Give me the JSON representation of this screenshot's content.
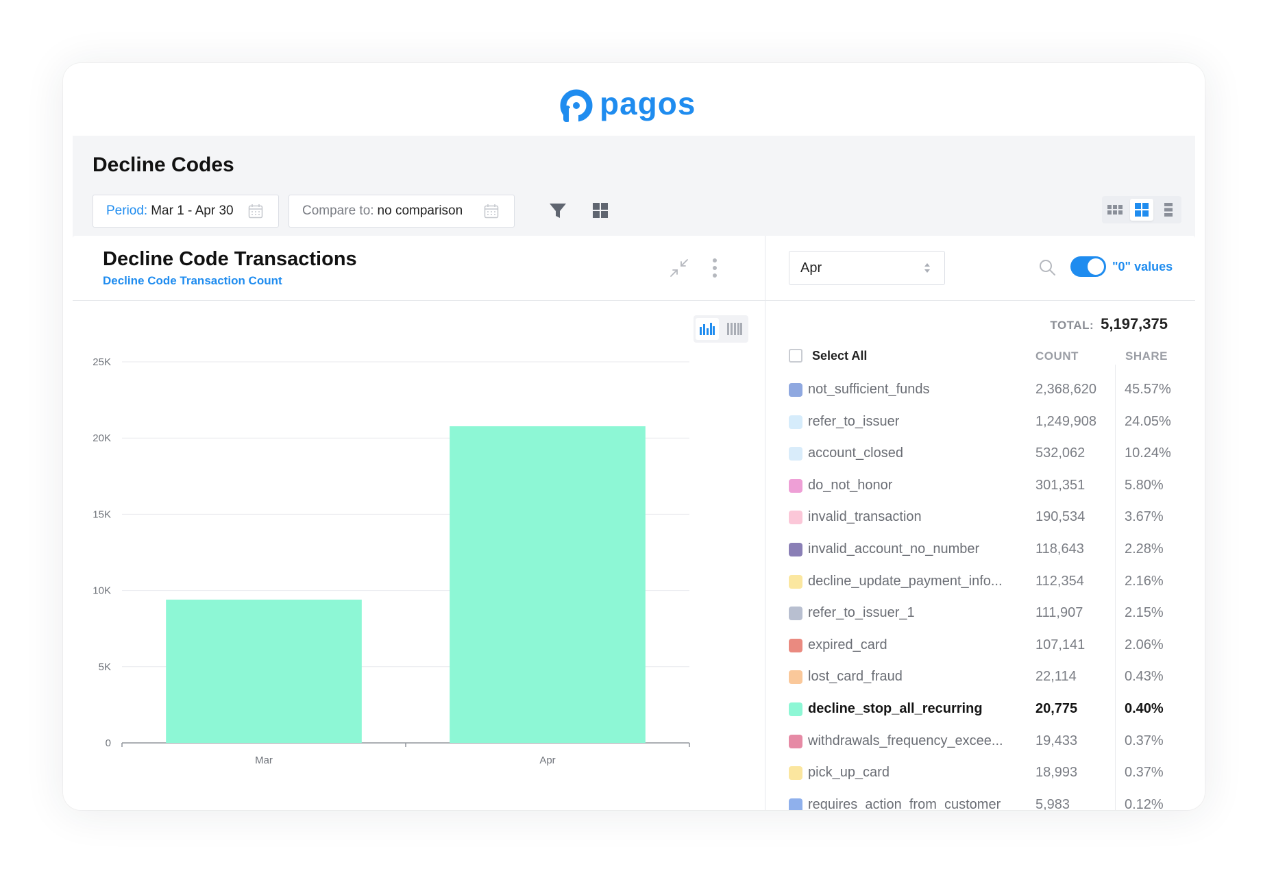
{
  "brand": {
    "name": "pagos",
    "color": "#1f8cef"
  },
  "page": {
    "title": "Decline Codes"
  },
  "filters": {
    "period_label": "Period:",
    "period_value": "Mar 1 - Apr 30",
    "compare_label": "Compare to:",
    "compare_value": "no comparison"
  },
  "panel": {
    "title": "Decline Code Transactions",
    "subtitle": "Decline Code Transaction Count"
  },
  "breakdown": {
    "month": "Apr",
    "toggle_label": "\"0\" values",
    "toggle_on": true,
    "total_label": "TOTAL:",
    "total_value": "5,197,375",
    "select_all": "Select All",
    "col_count": "COUNT",
    "col_share": "SHARE",
    "rows": [
      {
        "name": "not_sufficient_funds",
        "count": "2,368,620",
        "share": "45.57%",
        "color": "#8fa8e0"
      },
      {
        "name": "refer_to_issuer",
        "count": "1,249,908",
        "share": "24.05%",
        "color": "#d6ecfb"
      },
      {
        "name": "account_closed",
        "count": "532,062",
        "share": "10.24%",
        "color": "#d9ecfa"
      },
      {
        "name": "do_not_honor",
        "count": "301,351",
        "share": "5.80%",
        "color": "#ee9fd6"
      },
      {
        "name": "invalid_transaction",
        "count": "190,534",
        "share": "3.67%",
        "color": "#fbc7d8"
      },
      {
        "name": "invalid_account_no_number",
        "count": "118,643",
        "share": "2.28%",
        "color": "#8a7fb6"
      },
      {
        "name": "decline_update_payment_info...",
        "count": "112,354",
        "share": "2.16%",
        "color": "#fbe7a0"
      },
      {
        "name": "refer_to_issuer_1",
        "count": "111,907",
        "share": "2.15%",
        "color": "#b8bfd0"
      },
      {
        "name": "expired_card",
        "count": "107,141",
        "share": "2.06%",
        "color": "#ea8a80"
      },
      {
        "name": "lost_card_fraud",
        "count": "22,114",
        "share": "0.43%",
        "color": "#fac89a"
      },
      {
        "name": "decline_stop_all_recurring",
        "count": "20,775",
        "share": "0.40%",
        "color": "#8df7d5",
        "highlight": true
      },
      {
        "name": "withdrawals_frequency_excee...",
        "count": "19,433",
        "share": "0.37%",
        "color": "#e68aa5"
      },
      {
        "name": "pick_up_card",
        "count": "18,993",
        "share": "0.37%",
        "color": "#fbe69f"
      },
      {
        "name": "requires_action_from_customer",
        "count": "5,983",
        "share": "0.12%",
        "color": "#8fb0ec"
      }
    ]
  },
  "chart_data": {
    "type": "bar",
    "categories": [
      "Mar",
      "Apr"
    ],
    "values": [
      9400,
      20775
    ],
    "ylim": [
      0,
      25000
    ],
    "yticks": [
      "0",
      "5K",
      "10K",
      "15K",
      "20K",
      "25K"
    ],
    "ytick_values": [
      0,
      5000,
      10000,
      15000,
      20000,
      25000
    ],
    "grid": true,
    "bar_color": "#8df7d5"
  }
}
